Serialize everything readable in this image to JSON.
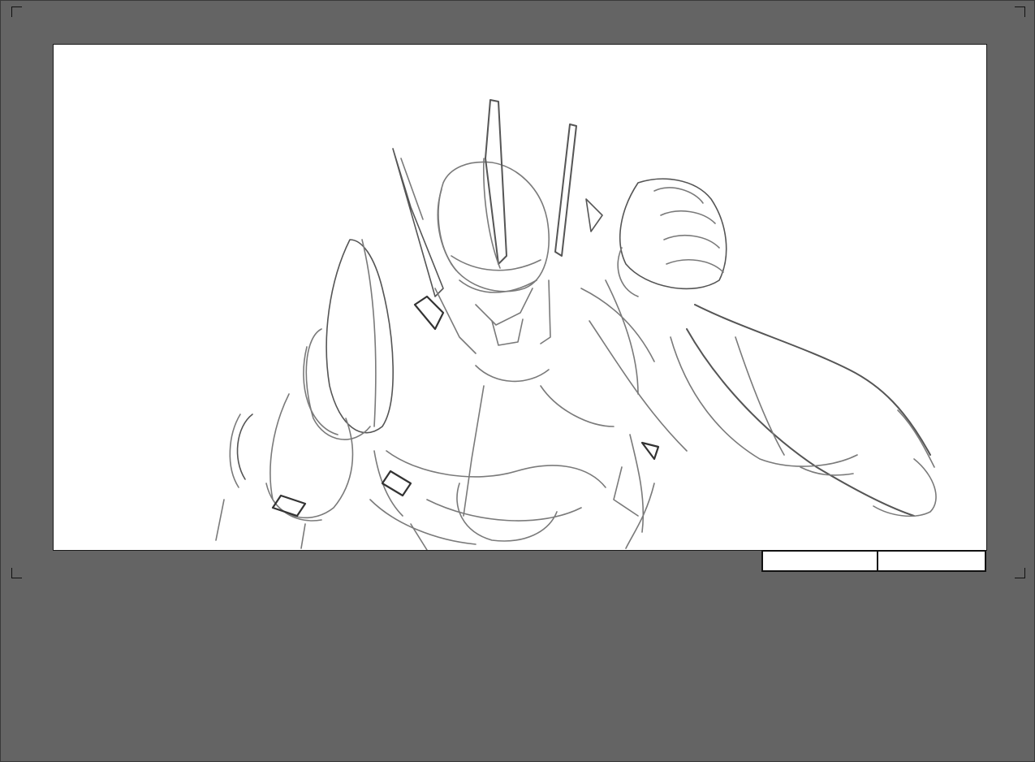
{
  "canvas": {
    "background": "#ffffff",
    "content": "storyboard-sketch"
  },
  "workspace": {
    "background": "#646464"
  },
  "panel_info": {
    "scene_value": "",
    "panel_value": ""
  }
}
